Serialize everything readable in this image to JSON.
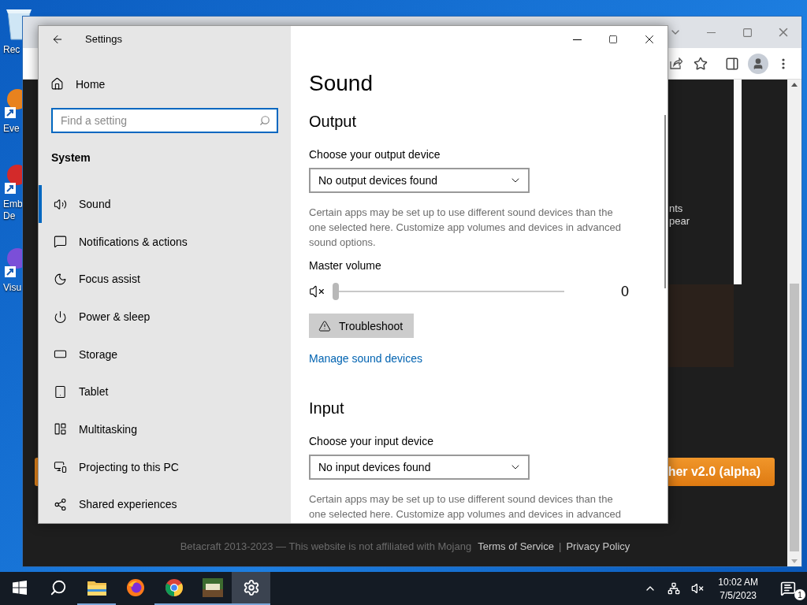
{
  "desktop": {
    "icons": [
      {
        "kind": "recycle",
        "lines": [
          "Rec"
        ]
      },
      {
        "kind": "orange",
        "lines": [
          "Eve"
        ]
      },
      {
        "kind": "red",
        "lines": [
          "Emb",
          "De"
        ]
      },
      {
        "kind": "purple",
        "lines": [
          "Visu"
        ]
      }
    ]
  },
  "browser": {
    "page": {
      "side_text": [
        "nts",
        "pear"
      ],
      "launch_button": "her v2.0 (alpha)",
      "footer": {
        "notice": "Betacraft 2013-2023 — This website is not affiliated with Mojang",
        "links": [
          "Terms of Service",
          "Privacy Policy"
        ],
        "separator": "|"
      }
    }
  },
  "settings": {
    "title": "Settings",
    "home": "Home",
    "search": {
      "placeholder": "Find a setting"
    },
    "group": "System",
    "items": [
      {
        "kind": "sound",
        "label": "Sound",
        "selected": true
      },
      {
        "kind": "notifications",
        "label": "Notifications & actions",
        "selected": false
      },
      {
        "kind": "focus",
        "label": "Focus assist",
        "selected": false
      },
      {
        "kind": "power",
        "label": "Power & sleep",
        "selected": false
      },
      {
        "kind": "storage",
        "label": "Storage",
        "selected": false
      },
      {
        "kind": "tablet",
        "label": "Tablet",
        "selected": false
      },
      {
        "kind": "multitasking",
        "label": "Multitasking",
        "selected": false
      },
      {
        "kind": "projecting",
        "label": "Projecting to this PC",
        "selected": false
      },
      {
        "kind": "shared",
        "label": "Shared experiences",
        "selected": false
      }
    ],
    "page_title": "Sound",
    "sections": [
      {
        "heading": "Output",
        "device_label": "Choose your output device",
        "device": "No output devices found",
        "description": "Certain apps may be set up to use different sound devices than the one selected here. Customize app volumes and devices in advanced sound options.",
        "volume": {
          "label": "Master volume",
          "muted": true,
          "level": 0,
          "reading": "0"
        },
        "troubleshoot": "Troubleshoot",
        "link": "Manage sound devices"
      },
      {
        "heading": "Input",
        "device_label": "Choose your input device",
        "device": "No input devices found",
        "description": "Certain apps may be set up to use different sound devices than the one selected here. Customize app volumes and devices in advanced"
      }
    ]
  },
  "taskbar": {
    "apps": [
      {
        "kind": "start",
        "running": false,
        "selected": false
      },
      {
        "kind": "search",
        "running": false,
        "selected": false
      },
      {
        "kind": "explorer",
        "running": true,
        "selected": false
      },
      {
        "kind": "firefox",
        "running": false,
        "selected": false
      },
      {
        "kind": "chrome",
        "running": true,
        "selected": false
      },
      {
        "kind": "game",
        "running": true,
        "selected": false
      },
      {
        "kind": "settings",
        "running": true,
        "selected": true
      }
    ],
    "time": "10:02 AM",
    "date": "7/5/2023",
    "notification_count": "1"
  }
}
